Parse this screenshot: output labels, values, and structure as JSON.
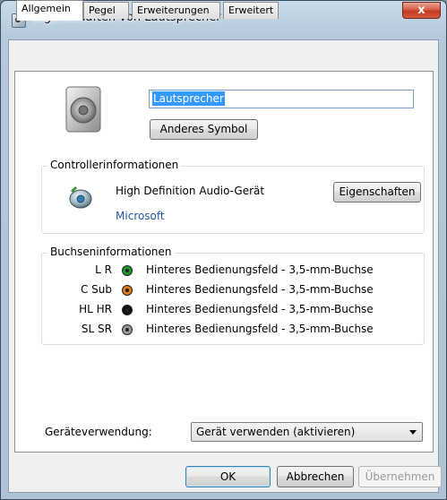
{
  "window": {
    "title": "Eigenschaften von Lautsprecher",
    "close_glyph": "x"
  },
  "tabs": [
    {
      "label": "Allgemein",
      "active": true
    },
    {
      "label": "Pegel"
    },
    {
      "label": "Erweiterungen"
    },
    {
      "label": "Erweitert"
    }
  ],
  "device": {
    "name_value": "Lautsprecher",
    "change_icon_label": "Anderes Symbol",
    "icon": "speaker-icon"
  },
  "controller": {
    "group_title": "Controllerinformationen",
    "name": "High Definition Audio-Gerät",
    "vendor": "Microsoft",
    "properties_label": "Eigenschaften",
    "icon": "audio-device-icon"
  },
  "jacks": {
    "group_title": "Buchseninformationen",
    "items": [
      {
        "channel": "L R",
        "description": "Hinteres Bedienungsfeld - 3,5-mm-Buchse",
        "color": "#1a9a2a"
      },
      {
        "channel": "C Sub",
        "description": "Hinteres Bedienungsfeld - 3,5-mm-Buchse",
        "color": "#e07a1a"
      },
      {
        "channel": "HL HR",
        "description": "Hinteres Bedienungsfeld - 3,5-mm-Buchse",
        "color": "#111111"
      },
      {
        "channel": "SL SR",
        "description": "Hinteres Bedienungsfeld - 3,5-mm-Buchse",
        "color": "#9a9a9a"
      }
    ]
  },
  "usage": {
    "label": "Geräteverwendung:",
    "selected": "Gerät verwenden (aktivieren)"
  },
  "buttons": {
    "ok": "OK",
    "cancel": "Abbrechen",
    "apply": "Übernehmen"
  }
}
